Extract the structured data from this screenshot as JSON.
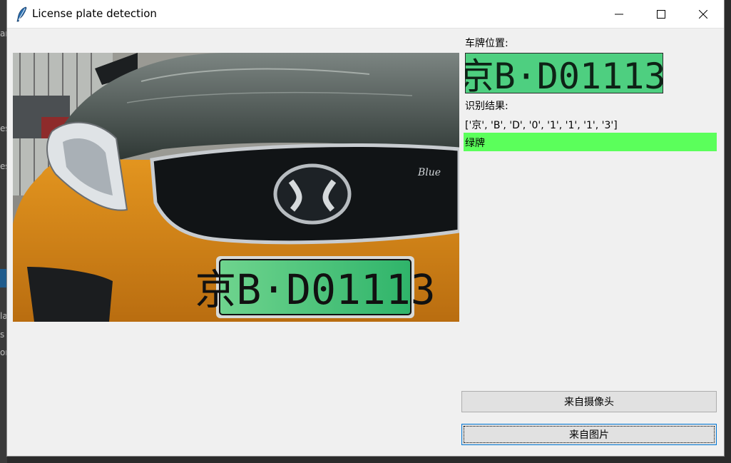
{
  "window": {
    "title": "License plate detection"
  },
  "background": {
    "left_fragments": [
      "ar",
      "es",
      "es",
      "la",
      "s",
      "or"
    ]
  },
  "plate_position": {
    "label": "车牌位置:"
  },
  "plate_image": {
    "text": "京B·D01113"
  },
  "car_image": {
    "plate_text": "京B·D01113",
    "badge_text": "Blue"
  },
  "result": {
    "label": "识别结果:",
    "chars": "['京', 'B', 'D', '0', '1', '1', '1', '3']",
    "plate_color": "绿牌"
  },
  "buttons": {
    "camera": "来自摄像头",
    "image": "来自图片"
  },
  "colors": {
    "plate_color_bar": "#5bff5b",
    "plate_green": "#3fbf73"
  }
}
